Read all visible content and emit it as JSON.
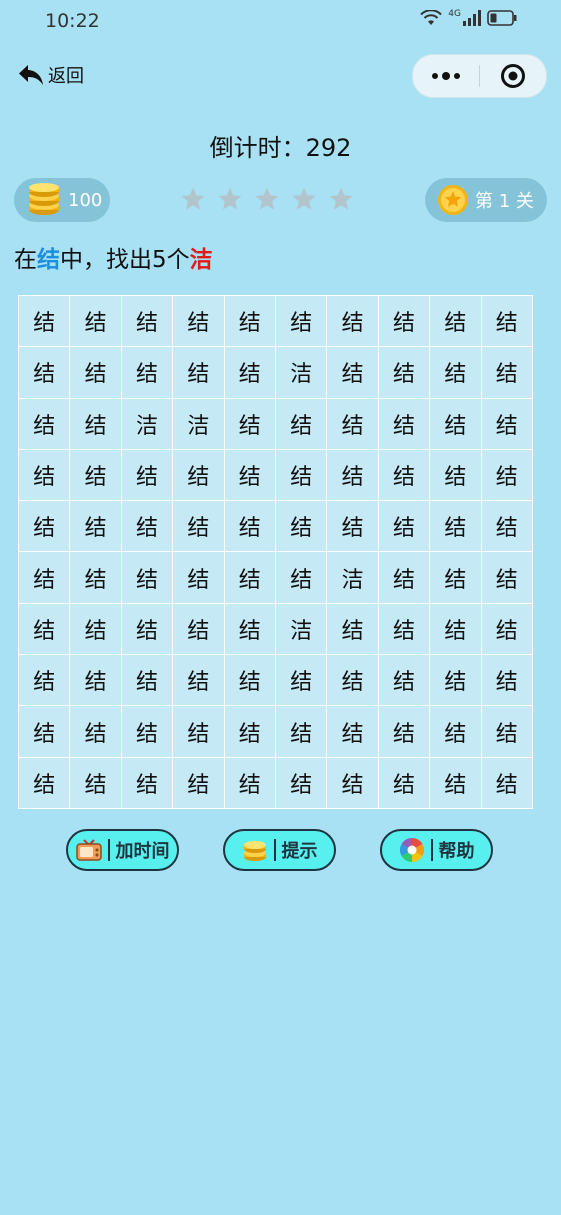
{
  "status_bar": {
    "time": "10:22",
    "network": "4G"
  },
  "nav": {
    "back_label": "返回"
  },
  "countdown": {
    "label": "倒计时：292"
  },
  "coins": {
    "value": "100"
  },
  "stars": {
    "total": 5,
    "filled": 0
  },
  "level": {
    "label": "第 1 关"
  },
  "instruction": {
    "prefix": "在",
    "base_char": "结",
    "middle": "中，找出5个",
    "target_char": "洁"
  },
  "grid": {
    "rows": [
      [
        "结",
        "结",
        "结",
        "结",
        "结",
        "结",
        "结",
        "结",
        "结",
        "结"
      ],
      [
        "结",
        "结",
        "结",
        "结",
        "结",
        "洁",
        "结",
        "结",
        "结",
        "结"
      ],
      [
        "结",
        "结",
        "洁",
        "洁",
        "结",
        "结",
        "结",
        "结",
        "结",
        "结"
      ],
      [
        "结",
        "结",
        "结",
        "结",
        "结",
        "结",
        "结",
        "结",
        "结",
        "结"
      ],
      [
        "结",
        "结",
        "结",
        "结",
        "结",
        "结",
        "结",
        "结",
        "结",
        "结"
      ],
      [
        "结",
        "结",
        "结",
        "结",
        "结",
        "结",
        "洁",
        "结",
        "结",
        "结"
      ],
      [
        "结",
        "结",
        "结",
        "结",
        "结",
        "洁",
        "结",
        "结",
        "结",
        "结"
      ],
      [
        "结",
        "结",
        "结",
        "结",
        "结",
        "结",
        "结",
        "结",
        "结",
        "结"
      ],
      [
        "结",
        "结",
        "结",
        "结",
        "结",
        "结",
        "结",
        "结",
        "结",
        "结"
      ],
      [
        "结",
        "结",
        "结",
        "结",
        "结",
        "结",
        "结",
        "结",
        "结",
        "结"
      ]
    ]
  },
  "buttons": {
    "add_time": "加时间",
    "hint": "提示",
    "help": "帮助"
  },
  "colors": {
    "background": "#a8e1f3",
    "cell": "#c5eaf5",
    "button": "#57f0ee",
    "highlight_blue": "#1d8fe0",
    "highlight_red": "#e11a1a"
  }
}
